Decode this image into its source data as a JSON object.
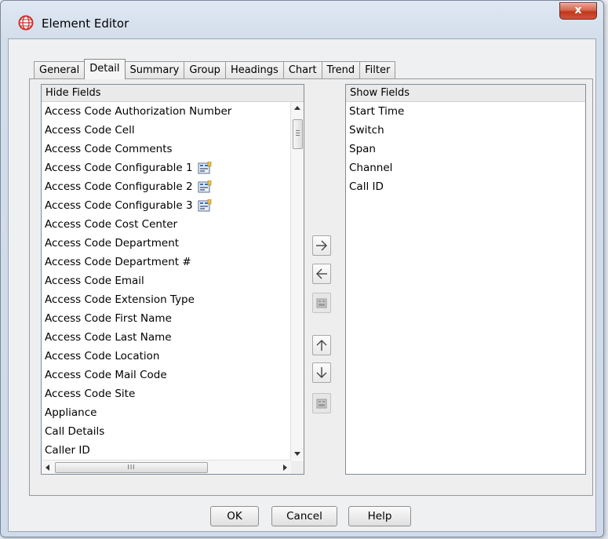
{
  "window": {
    "title": "Element Editor",
    "close_symbol": "x"
  },
  "tabs": [
    {
      "label": "General",
      "active": false
    },
    {
      "label": "Detail",
      "active": true
    },
    {
      "label": "Summary",
      "active": false
    },
    {
      "label": "Group",
      "active": false
    },
    {
      "label": "Headings",
      "active": false
    },
    {
      "label": "Chart",
      "active": false
    },
    {
      "label": "Trend",
      "active": false
    },
    {
      "label": "Filter",
      "active": false
    }
  ],
  "hide_fields": {
    "header": "Hide Fields",
    "items": [
      {
        "label": "Access Code Authorization Number",
        "icon": ""
      },
      {
        "label": "Access Code Cell",
        "icon": ""
      },
      {
        "label": "Access Code Comments",
        "icon": ""
      },
      {
        "label": "Access Code Configurable 1",
        "icon": "configure-icon"
      },
      {
        "label": "Access Code Configurable 2",
        "icon": "configure-icon"
      },
      {
        "label": "Access Code Configurable 3",
        "icon": "configure-icon"
      },
      {
        "label": "Access Code Cost Center",
        "icon": ""
      },
      {
        "label": "Access Code Department",
        "icon": ""
      },
      {
        "label": "Access Code Department #",
        "icon": ""
      },
      {
        "label": "Access Code Email",
        "icon": ""
      },
      {
        "label": "Access Code Extension Type",
        "icon": ""
      },
      {
        "label": "Access Code First Name",
        "icon": ""
      },
      {
        "label": "Access Code Last Name",
        "icon": ""
      },
      {
        "label": "Access Code Location",
        "icon": ""
      },
      {
        "label": "Access Code Mail Code",
        "icon": ""
      },
      {
        "label": "Access Code Site",
        "icon": ""
      },
      {
        "label": "Appliance",
        "icon": ""
      },
      {
        "label": "Call Details",
        "icon": ""
      },
      {
        "label": "Caller ID",
        "icon": ""
      }
    ]
  },
  "show_fields": {
    "header": "Show Fields",
    "items": [
      "Start Time",
      "Switch",
      "Span",
      "Channel",
      "Call ID"
    ]
  },
  "move_buttons": [
    {
      "name": "move-right-button",
      "icon": "arrow-right-icon",
      "enabled": true
    },
    {
      "name": "move-left-button",
      "icon": "arrow-left-icon",
      "enabled": true
    },
    {
      "name": "configure-button",
      "icon": "configure-icon",
      "enabled": false
    },
    {
      "name": "move-up-button",
      "icon": "arrow-up-icon",
      "enabled": true
    },
    {
      "name": "move-down-button",
      "icon": "arrow-down-icon",
      "enabled": true
    },
    {
      "name": "configure-button-2",
      "icon": "configure-icon",
      "enabled": false
    }
  ],
  "hscroll_grip": "III",
  "buttons": {
    "ok": "OK",
    "cancel": "Cancel",
    "help": "Help"
  },
  "colors": {
    "close_button": "#c7412a",
    "app_icon": "#d0312d"
  }
}
